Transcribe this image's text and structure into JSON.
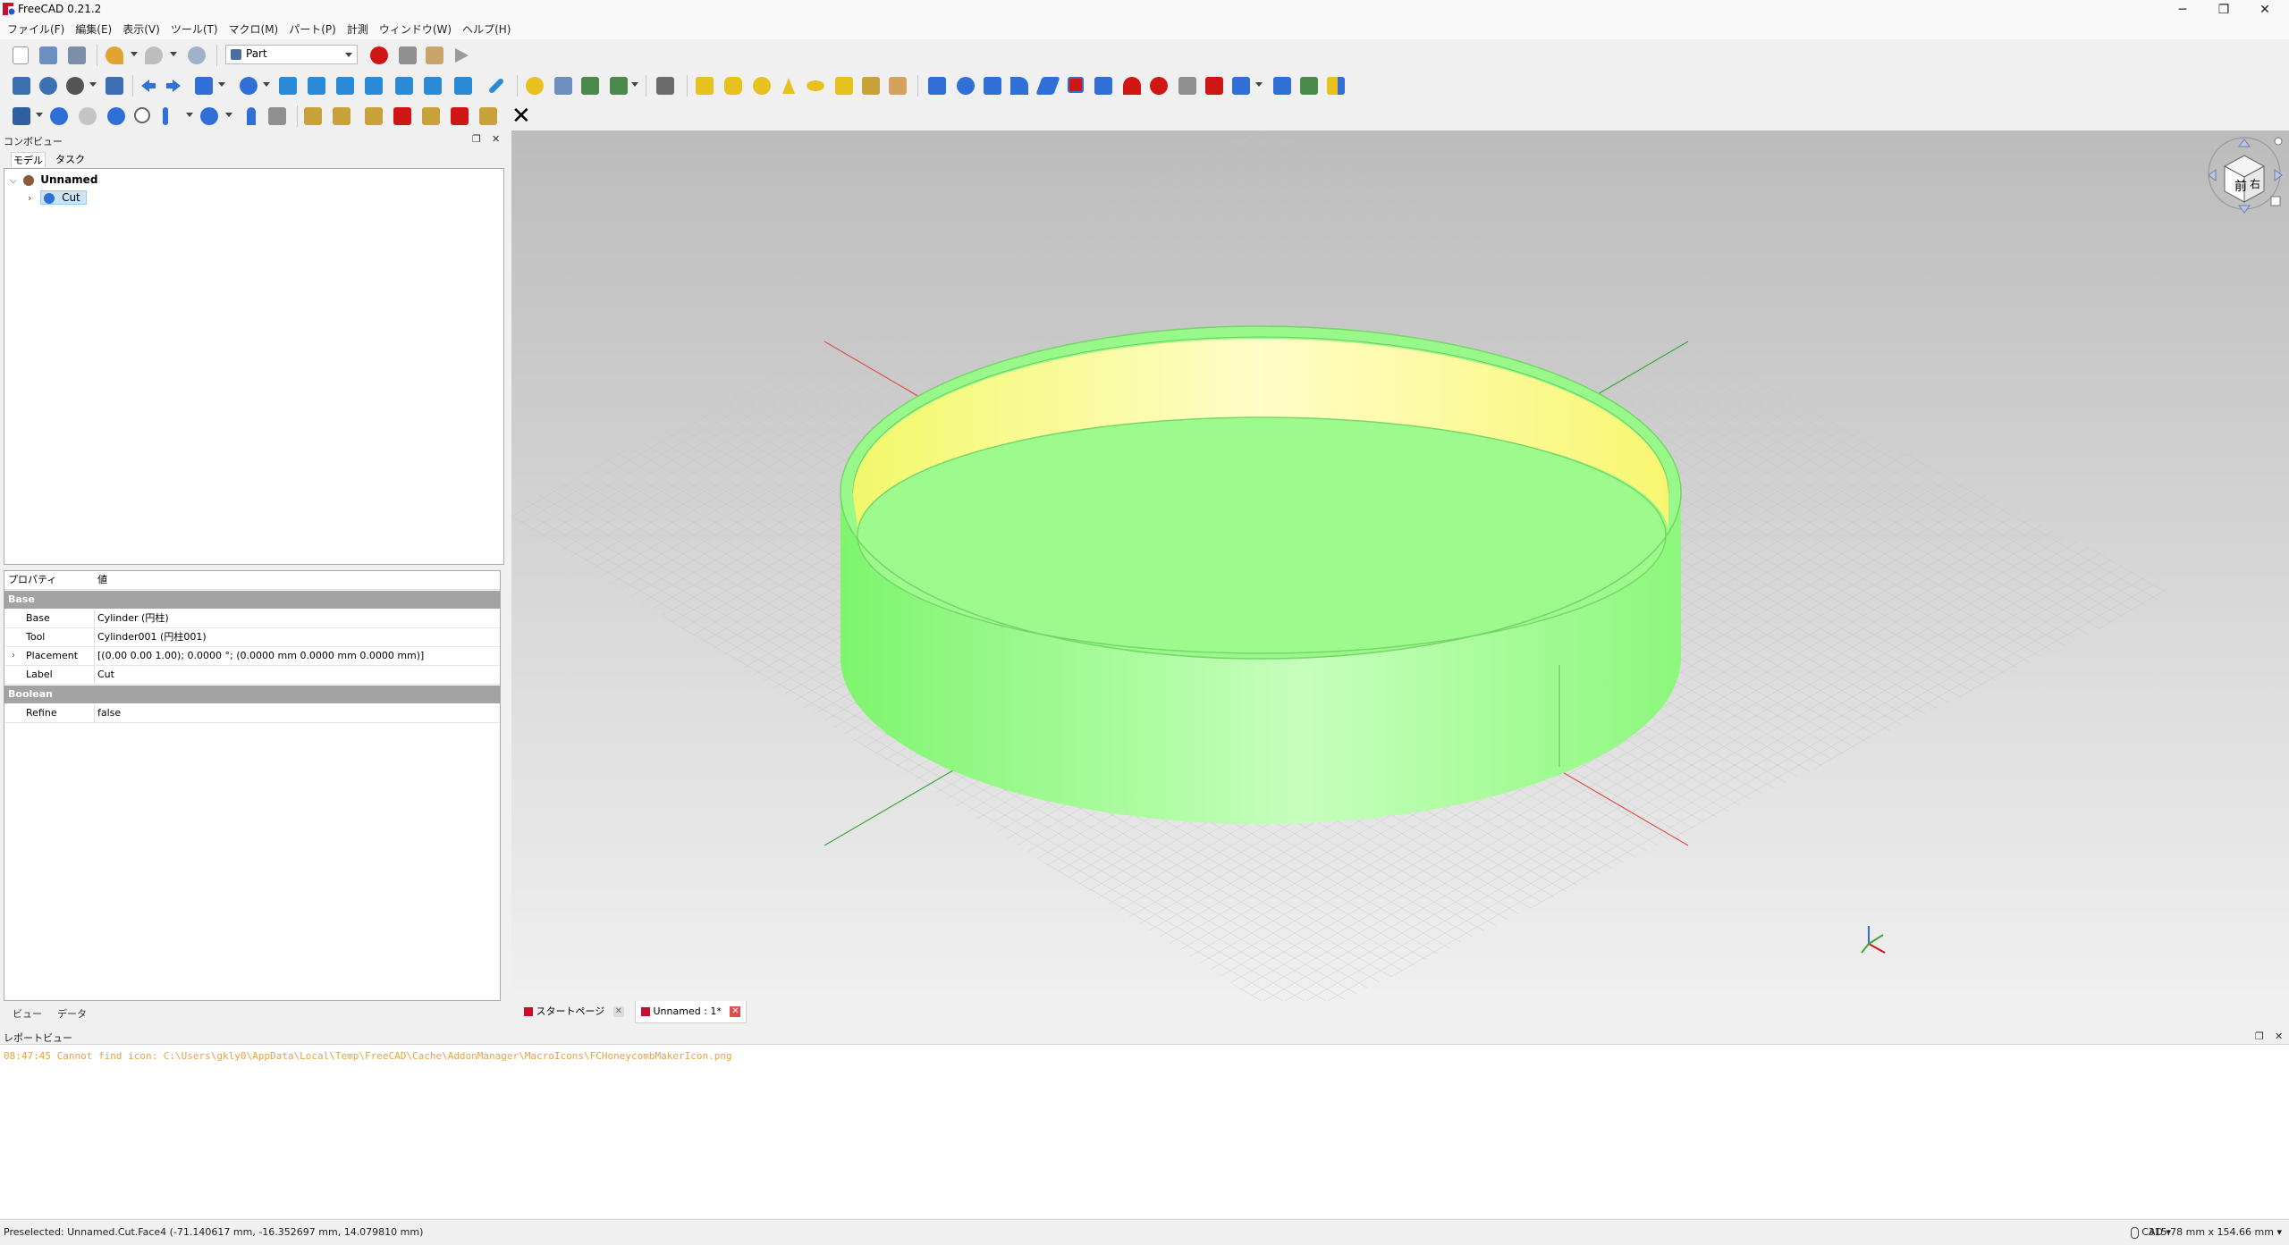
{
  "window": {
    "title": "FreeCAD 0.21.2",
    "controls": {
      "minimize": "─",
      "restore": "❐",
      "close": "✕"
    }
  },
  "menu": [
    "ファイル(F)",
    "編集(E)",
    "表示(V)",
    "ツール(T)",
    "マクロ(M)",
    "パート(P)",
    "計測",
    "ウィンドウ(W)",
    "ヘルプ(H)"
  ],
  "toolbar": {
    "workbench": "Part",
    "close_glyph": "✕",
    "record_color": "#d01515",
    "accent_yellow": "#e7c21f",
    "accent_blue": "#2f6fd6"
  },
  "combo_view": {
    "title": "コンボビュー",
    "tabs": [
      "モデル",
      "タスク"
    ],
    "tree": {
      "root": "Unnamed",
      "child": "Cut"
    },
    "properties": {
      "header_property": "プロパティ",
      "header_value": "値",
      "groups": [
        {
          "name": "Base",
          "rows": [
            {
              "name": "Base",
              "value": "Cylinder (円柱)"
            },
            {
              "name": "Tool",
              "value": "Cylinder001 (円柱001)"
            },
            {
              "name": "Placement",
              "value": "[(0.00 0.00 1.00); 0.0000 °; (0.0000 mm  0.0000 mm  0.0000 mm)]"
            },
            {
              "name": "Label",
              "value": "Cut"
            }
          ]
        },
        {
          "name": "Boolean",
          "rows": [
            {
              "name": "Refine",
              "value": "false"
            }
          ]
        }
      ]
    },
    "bottom_tabs": [
      "ビュー",
      "データ"
    ]
  },
  "viewport": {
    "nav_cube": {
      "face_top": "前",
      "face_right": "右"
    },
    "background_top": "#bdbdbd",
    "background_bottom": "#efefef",
    "model_color": "#9cfb8c",
    "model_inner_color": "#fefca0"
  },
  "document_tabs": [
    {
      "label": "スタートページ",
      "active": false
    },
    {
      "label": "Unnamed : 1*",
      "active": true
    }
  ],
  "report_view": {
    "title": "レポートビュー",
    "lines": [
      "08:47:45  Cannot find icon: C:\\Users\\gkly0\\AppData\\Local\\Temp\\FreeCAD\\Cache\\AddonManager\\MacroIcons\\FCHoneycombMakerIcon.png"
    ],
    "line_color": "#e8a33c"
  },
  "status_bar": {
    "message": "Preselected: Unnamed.Cut.Face4 (-71.140617 mm, -16.352697 mm, 14.079810 mm)",
    "navigation": "CAD",
    "dimensions": "315.78 mm x 154.66 mm"
  }
}
